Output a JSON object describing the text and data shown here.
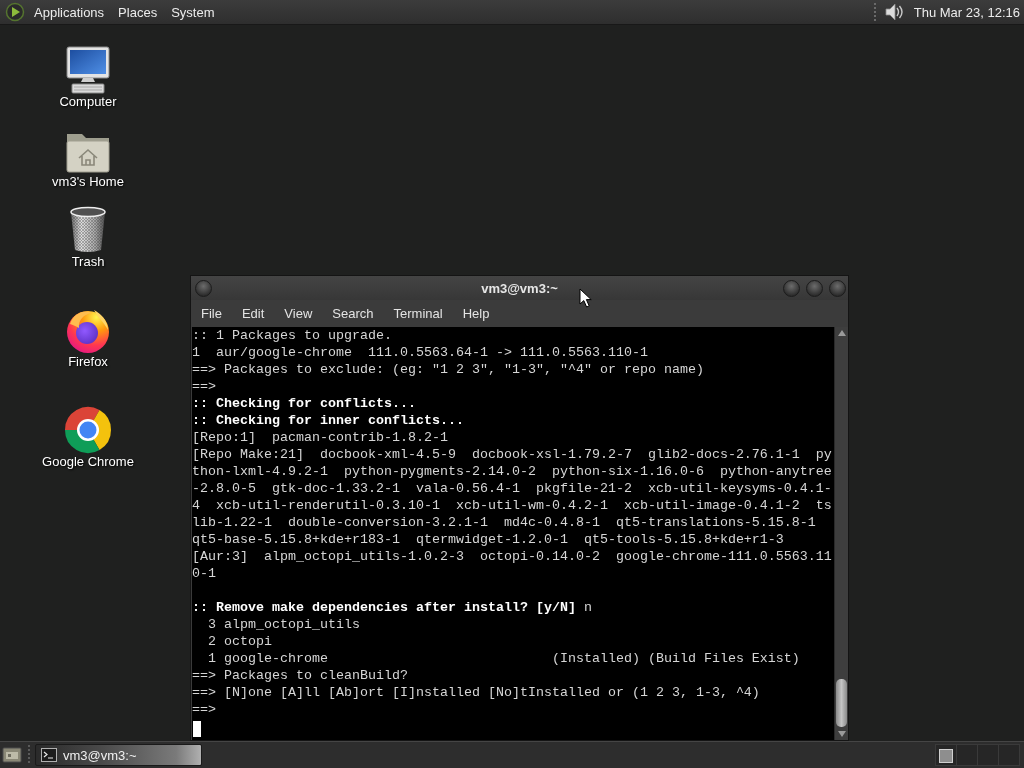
{
  "top_panel": {
    "menus": [
      "Applications",
      "Places",
      "System"
    ],
    "clock": "Thu Mar 23, 12:16"
  },
  "desktop_icons": [
    {
      "label": "Computer",
      "kind": "computer"
    },
    {
      "label": "vm3's Home",
      "kind": "home"
    },
    {
      "label": "Trash",
      "kind": "trash"
    },
    {
      "label": "Firefox",
      "kind": "firefox"
    },
    {
      "label": "Google Chrome",
      "kind": "chrome"
    }
  ],
  "terminal_window": {
    "title": "vm3@vm3:~",
    "menu": [
      "File",
      "Edit",
      "View",
      "Search",
      "Terminal",
      "Help"
    ],
    "output_blocks": [
      {
        "lines": [
          {
            "text": ":: 1 Packages to upgrade.",
            "bold": false
          },
          {
            "text": "1  aur/google-chrome  111.0.5563.64-1 -> 111.0.5563.110-1",
            "bold": false
          },
          {
            "text": "==> Packages to exclude: (eg: \"1 2 3\", \"1-3\", \"^4\" or repo name)",
            "bold": false
          },
          {
            "text": "==>",
            "bold": false
          },
          {
            "text": ":: Checking for conflicts...",
            "bold": true
          },
          {
            "text": ":: Checking for inner conflicts...",
            "bold": true
          },
          {
            "text": "[Repo:1]  pacman-contrib-1.8.2-1",
            "bold": false
          },
          {
            "text": "[Repo Make:21]  docbook-xml-4.5-9  docbook-xsl-1.79.2-7  glib2-docs-2.76.1-1  py",
            "bold": false
          },
          {
            "text": "thon-lxml-4.9.2-1  python-pygments-2.14.0-2  python-six-1.16.0-6  python-anytree",
            "bold": false
          },
          {
            "text": "-2.8.0-5  gtk-doc-1.33.2-1  vala-0.56.4-1  pkgfile-21-2  xcb-util-keysyms-0.4.1-",
            "bold": false
          },
          {
            "text": "4  xcb-util-renderutil-0.3.10-1  xcb-util-wm-0.4.2-1  xcb-util-image-0.4.1-2  ts",
            "bold": false
          },
          {
            "text": "lib-1.22-1  double-conversion-3.2.1-1  md4c-0.4.8-1  qt5-translations-5.15.8-1",
            "bold": false
          },
          {
            "text": "qt5-base-5.15.8+kde+r183-1  qtermwidget-1.2.0-1  qt5-tools-5.15.8+kde+r1-3",
            "bold": false
          },
          {
            "text": "[Aur:3]  alpm_octopi_utils-1.0.2-3  octopi-0.14.0-2  google-chrome-111.0.5563.11",
            "bold": false
          },
          {
            "text": "0-1",
            "bold": false
          }
        ]
      },
      {
        "lines": [
          {
            "text": "**:: Remove make dependencies after install? [y/N]** n",
            "bold": false
          },
          {
            "text": "  3 alpm_octopi_utils",
            "bold": false
          },
          {
            "text": "  2 octopi",
            "bold": false
          },
          {
            "text": "  1 google-chrome                            (Installed) (Build Files Exist)",
            "bold": false
          },
          {
            "text": "==> Packages to cleanBuild?",
            "bold": false
          },
          {
            "text": "==> [N]one [A]ll [Ab]ort [I]nstalled [No]tInstalled or (1 2 3, 1-3, ^4)",
            "bold": false
          },
          {
            "text": "==>",
            "bold": false
          }
        ]
      }
    ],
    "cursor": true
  },
  "taskbar": {
    "tasks": [
      {
        "label": "vm3@vm3:~",
        "selected": true
      }
    ]
  }
}
